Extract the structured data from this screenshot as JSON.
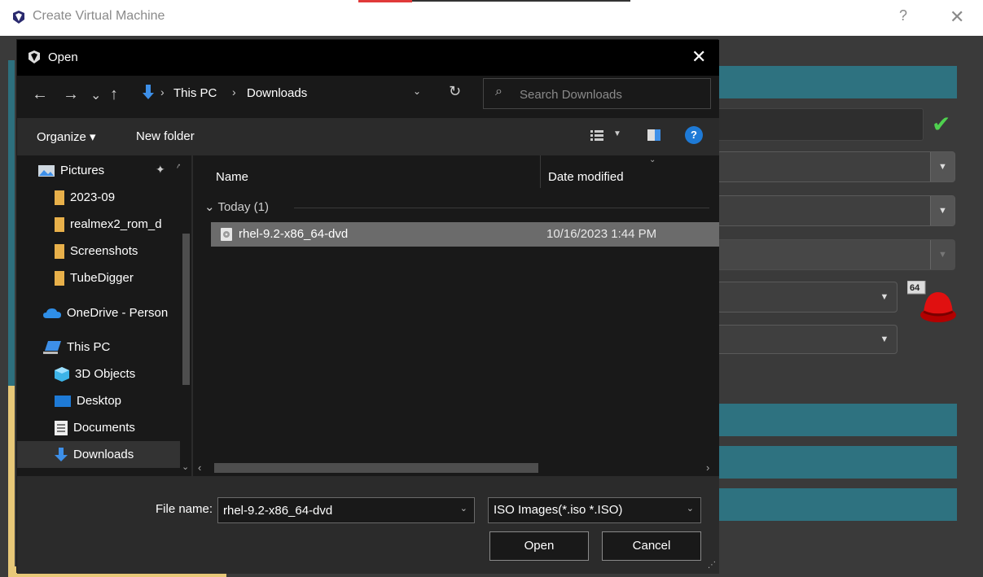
{
  "background_window": {
    "title": "Create Virtual Machine",
    "help_label": "?",
    "close_label": "✕",
    "colors": {
      "accent_teal": "#2e7280",
      "accent_yellow": "#e7c878",
      "check_green": "#4fd14f"
    },
    "os_badge": "64"
  },
  "dialog": {
    "title": "Open",
    "close_label": "✕",
    "nav": {
      "back": "←",
      "forward": "→",
      "recent": "⌄",
      "up": "↑"
    },
    "address": {
      "segments": [
        "This PC",
        "Downloads"
      ],
      "separator": "›",
      "dropdown": "⌄",
      "refresh": "↻"
    },
    "search": {
      "placeholder": "Search Downloads"
    },
    "toolbar": {
      "organize": "Organize ▾",
      "new_folder": "New folder",
      "help": "?"
    },
    "tree": [
      {
        "label": "Pictures",
        "icon": "pictures-icon"
      },
      {
        "label": "2023-09",
        "icon": "folder-icon"
      },
      {
        "label": "realmex2_rom_d",
        "icon": "folder-icon"
      },
      {
        "label": "Screenshots",
        "icon": "folder-icon"
      },
      {
        "label": "TubeDigger",
        "icon": "folder-icon"
      },
      {
        "label": "OneDrive - Person",
        "icon": "onedrive-icon"
      },
      {
        "label": "This PC",
        "icon": "this-pc-icon"
      },
      {
        "label": "3D Objects",
        "icon": "3d-objects-icon"
      },
      {
        "label": "Desktop",
        "icon": "desktop-icon"
      },
      {
        "label": "Documents",
        "icon": "documents-icon"
      },
      {
        "label": "Downloads",
        "icon": "downloads-icon",
        "selected": true
      }
    ],
    "columns": {
      "name": "Name",
      "date": "Date modified"
    },
    "group": {
      "label": "Today (1)"
    },
    "files": [
      {
        "name": "rhel-9.2-x86_64-dvd",
        "date": "10/16/2023 1:44 PM",
        "selected": true
      }
    ],
    "bottom": {
      "file_name_label": "File name:",
      "file_name_value": "rhel-9.2-x86_64-dvd",
      "filter": "ISO Images(*.iso *.ISO)",
      "open_button": "Open",
      "cancel_button": "Cancel"
    }
  }
}
